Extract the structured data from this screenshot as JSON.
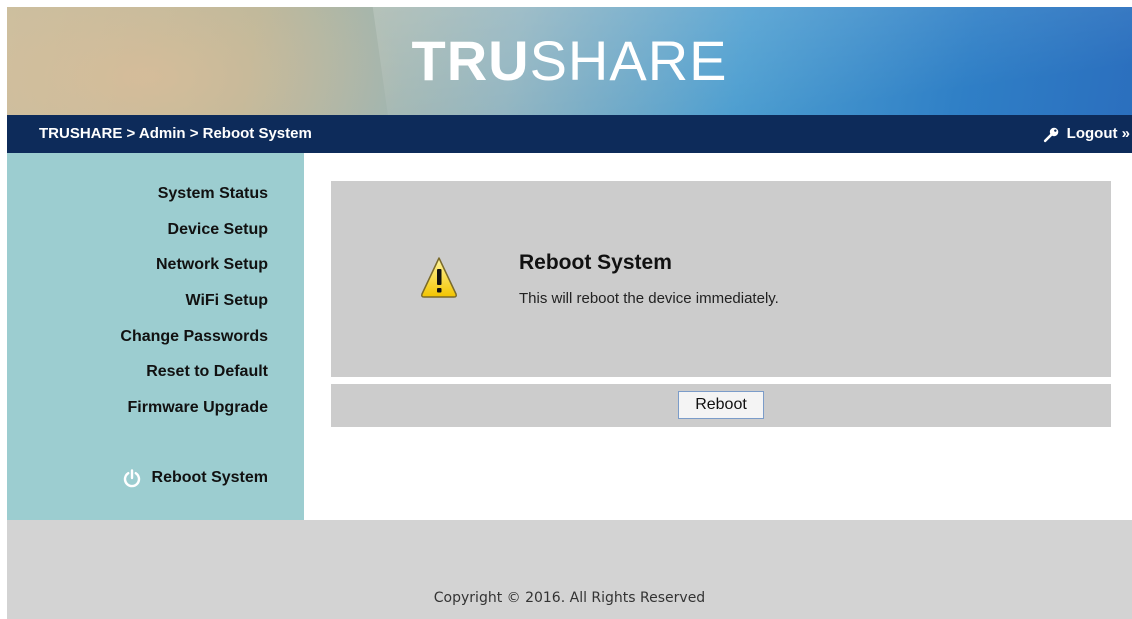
{
  "brand": {
    "logo_bold": "TRU",
    "logo_light": "SHARE"
  },
  "header": {
    "breadcrumb": "TRUSHARE > Admin > Reboot System",
    "logout_label": "Logout »",
    "logout_icon": "key-icon"
  },
  "sidebar": {
    "items": [
      {
        "label": "System Status"
      },
      {
        "label": "Device Setup"
      },
      {
        "label": "Network Setup"
      },
      {
        "label": "WiFi Setup"
      },
      {
        "label": "Change Passwords"
      },
      {
        "label": "Reset to Default"
      },
      {
        "label": "Firmware Upgrade"
      }
    ],
    "reboot": {
      "label": "Reboot System",
      "icon": "power-icon"
    }
  },
  "main": {
    "title": "Reboot System",
    "description": "This will reboot the device immediately.",
    "warning_icon": "warning-icon",
    "reboot_button": "Reboot"
  },
  "footer": {
    "copyright": "Copyright © 2016. All Rights Reserved"
  },
  "colors": {
    "navbar": "#0d2b5a",
    "sidebar": "#9ccdd0",
    "panel": "#cccccc",
    "footer": "#d3d3d3",
    "warning": "#f5d000"
  }
}
